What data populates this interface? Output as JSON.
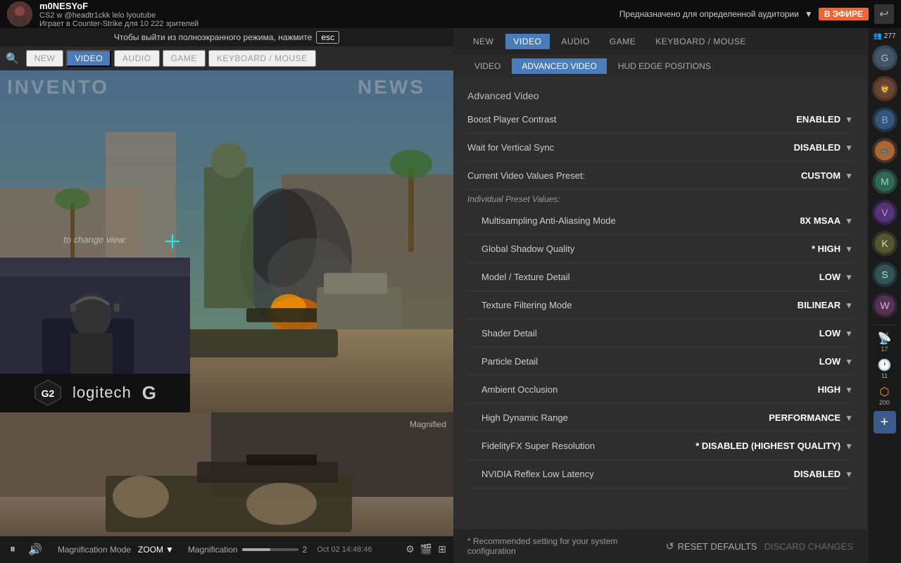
{
  "topbar": {
    "streamer_name": "m0NESYoF",
    "game_info": "CS2 w @headtr1ckk lelo lyoutube",
    "viewers_text": "Играет в Counter-Strike для 10 222 зрителей",
    "audience_label": "Предназначено для определенной аудитории",
    "live_badge": "В ЭФИРЕ",
    "viewer_count": "277"
  },
  "exit_fullscreen": {
    "text": "Чтобы выйти из полноэкранного режима, нажмите",
    "key": "esc"
  },
  "nav": {
    "tabs": [
      {
        "label": "NEW",
        "active": false
      },
      {
        "label": "VIDEO",
        "active": true
      },
      {
        "label": "AUDIO",
        "active": false
      },
      {
        "label": "GAME",
        "active": false
      },
      {
        "label": "KEYBOARD / MOUSE",
        "active": false
      }
    ]
  },
  "sub_nav": {
    "tabs": [
      {
        "label": "VIDEO",
        "active": false
      },
      {
        "label": "ADVANCED VIDEO",
        "active": true
      },
      {
        "label": "HUD EDGE POSITIONS",
        "active": false
      }
    ]
  },
  "settings": {
    "section_title": "Advanced Video",
    "rows": [
      {
        "label": "Boost Player Contrast",
        "value": "ENABLED",
        "star": false
      },
      {
        "label": "Wait for Vertical Sync",
        "value": "DISABLED",
        "star": false
      },
      {
        "label": "Current Video Values Preset:",
        "value": "CUSTOM",
        "star": false
      }
    ],
    "preset_label": "Individual Preset Values:",
    "preset_rows": [
      {
        "label": "Multisampling Anti-Aliasing Mode",
        "value": "8X MSAA",
        "star": false
      },
      {
        "label": "Global Shadow Quality",
        "value": "HIGH",
        "star": true
      },
      {
        "label": "Model / Texture Detail",
        "value": "LOW",
        "star": false
      },
      {
        "label": "Texture Filtering Mode",
        "value": "BILINEAR",
        "star": false
      },
      {
        "label": "Shader Detail",
        "value": "LOW",
        "star": false
      },
      {
        "label": "Particle Detail",
        "value": "LOW",
        "star": false
      },
      {
        "label": "Ambient Occlusion",
        "value": "HIGH",
        "star": false
      },
      {
        "label": "High Dynamic Range",
        "value": "PERFORMANCE",
        "star": false
      },
      {
        "label": "FidelityFX Super Resolution",
        "value": "DISABLED (HIGHEST QUALITY)",
        "star": true
      },
      {
        "label": "NVIDIA Reflex Low Latency",
        "value": "DISABLED",
        "star": false
      }
    ]
  },
  "bottom_bar": {
    "recommended_text": "* Recommended setting for your system configuration",
    "reset_label": "RESET DEFAULTS",
    "discard_label": "DISCARD CHANGES"
  },
  "controls": {
    "mag_mode_label": "Magnification Mode",
    "mag_mode_value": "ZOOM",
    "mag_label": "Magnification",
    "mag_value": "2",
    "timestamp": "Oct 02  14:48:46"
  },
  "sidebar": {
    "viewer_count": "277",
    "counts": [
      {
        "id": "history",
        "val": "11"
      },
      {
        "id": "points",
        "val": "200"
      }
    ]
  },
  "page_overlays": {
    "left_text": "INVENTO",
    "right_text": "NEWS"
  }
}
